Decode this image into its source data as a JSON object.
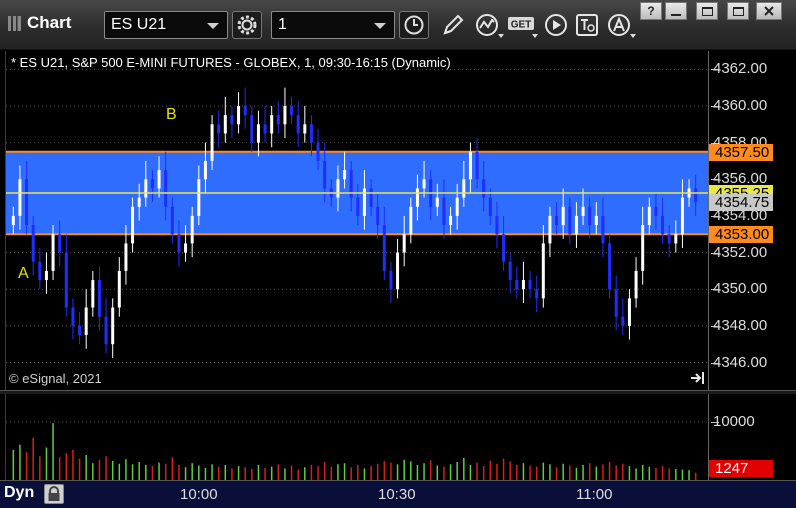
{
  "window": {
    "title": "Chart"
  },
  "toolbar": {
    "symbol": "ES U21",
    "interval": "1",
    "get_label": "GET"
  },
  "chart": {
    "header": "* ES U21, S&P 500 E-MINI FUTURES - GLOBEX, 1, 09:30-16:15 (Dynamic)",
    "copyright": "© eSignal, 2021",
    "annotation_a": "A",
    "annotation_b": "B",
    "price_labels": [
      "4362.00",
      "4360.00",
      "4358.00",
      "4356.00",
      "4354.00",
      "4352.00",
      "4350.00",
      "4348.00",
      "4346.00"
    ],
    "band_upper_label": "4357.50",
    "band_lower_label": "4353.00",
    "last_price_label": "4355.25",
    "current_price_label": "4354.75",
    "volume_axis_label": "10000",
    "last_volume_label": "1247",
    "time_labels": [
      "10:00",
      "10:30",
      "11:00"
    ],
    "mode_label": "Dyn"
  },
  "colors": {
    "band": "#2f6dff",
    "band_border": "#ff8a1e",
    "up_candle": "#ffffff",
    "down_candle": "#1f2dff",
    "last_price_line": "#e8e84a",
    "volume_up": "#5ad042",
    "volume_down": "#d81e1e",
    "last_volume_badge": "#e00000"
  },
  "chart_data": {
    "type": "candlestick",
    "y_range": [
      4344.5,
      4363.0
    ],
    "band": {
      "upper": 4357.5,
      "lower": 4353.0
    },
    "last_price": 4355.25,
    "current_price": 4354.75,
    "closes": [
      4354.0,
      4356.0,
      4353.5,
      4351.5,
      4350.5,
      4351.0,
      4353.0,
      4352.0,
      4349.0,
      4348.0,
      4347.5,
      4349.0,
      4350.5,
      4348.5,
      4347.0,
      4349.0,
      4351.0,
      4352.5,
      4354.5,
      4355.0,
      4356.0,
      4355.5,
      4356.5,
      4354.5,
      4353.0,
      4352.0,
      4352.5,
      4354.0,
      4356.0,
      4357.0,
      4359.0,
      4358.5,
      4359.5,
      4359.0,
      4360.0,
      4359.5,
      4358.0,
      4359.0,
      4358.5,
      4359.5,
      4359.0,
      4360.0,
      4359.5,
      4358.5,
      4359.0,
      4358.0,
      4357.0,
      4355.5,
      4355.0,
      4356.0,
      4356.5,
      4355.0,
      4354.0,
      4355.5,
      4354.5,
      4353.5,
      4351.0,
      4350.0,
      4352.0,
      4353.0,
      4354.5,
      4355.5,
      4356.0,
      4354.5,
      4355.0,
      4353.5,
      4354.0,
      4355.0,
      4356.0,
      4357.5,
      4356.0,
      4355.0,
      4354.0,
      4353.0,
      4351.5,
      4350.5,
      4350.0,
      4350.5,
      4350.0,
      4349.5,
      4352.5,
      4354.0,
      4353.5,
      4354.5,
      4353.0,
      4354.0,
      4354.5,
      4353.5,
      4354.0,
      4352.5,
      4350.0,
      4348.5,
      4348.0,
      4349.5,
      4351.0,
      4353.5,
      4354.5,
      4354.0,
      4353.0,
      4352.5,
      4353.0,
      4355.0,
      4355.5,
      4354.75
    ],
    "volumes": [
      5200,
      6100,
      4800,
      7300,
      4100,
      5600,
      9800,
      3900,
      4600,
      5200,
      3700,
      4300,
      2900,
      3500,
      4100,
      3300,
      2800,
      3600,
      2700,
      3100,
      2600,
      2400,
      3000,
      2800,
      3900,
      2600,
      2200,
      2900,
      2500,
      2100,
      2700,
      2300,
      2600,
      2000,
      2400,
      2200,
      1900,
      2600,
      2100,
      2300,
      2700,
      2000,
      2500,
      1800,
      2200,
      2600,
      2400,
      3100,
      2300,
      2700,
      2900,
      2200,
      2600,
      2000,
      2400,
      2800,
      3300,
      3000,
      2700,
      3500,
      3200,
      2600,
      2900,
      3400,
      2500,
      2300,
      2700,
      3100,
      3800,
      2600,
      3000,
      2400,
      3300,
      2800,
      3700,
      3200,
      2600,
      2900,
      2500,
      2300,
      3000,
      2700,
      2200,
      2800,
      2500,
      2100,
      2600,
      2900,
      2300,
      2700,
      3100,
      2500,
      2800,
      2400,
      2000,
      2600,
      2300,
      2100,
      2400,
      2000,
      1900,
      1800,
      1700,
      1247
    ]
  }
}
